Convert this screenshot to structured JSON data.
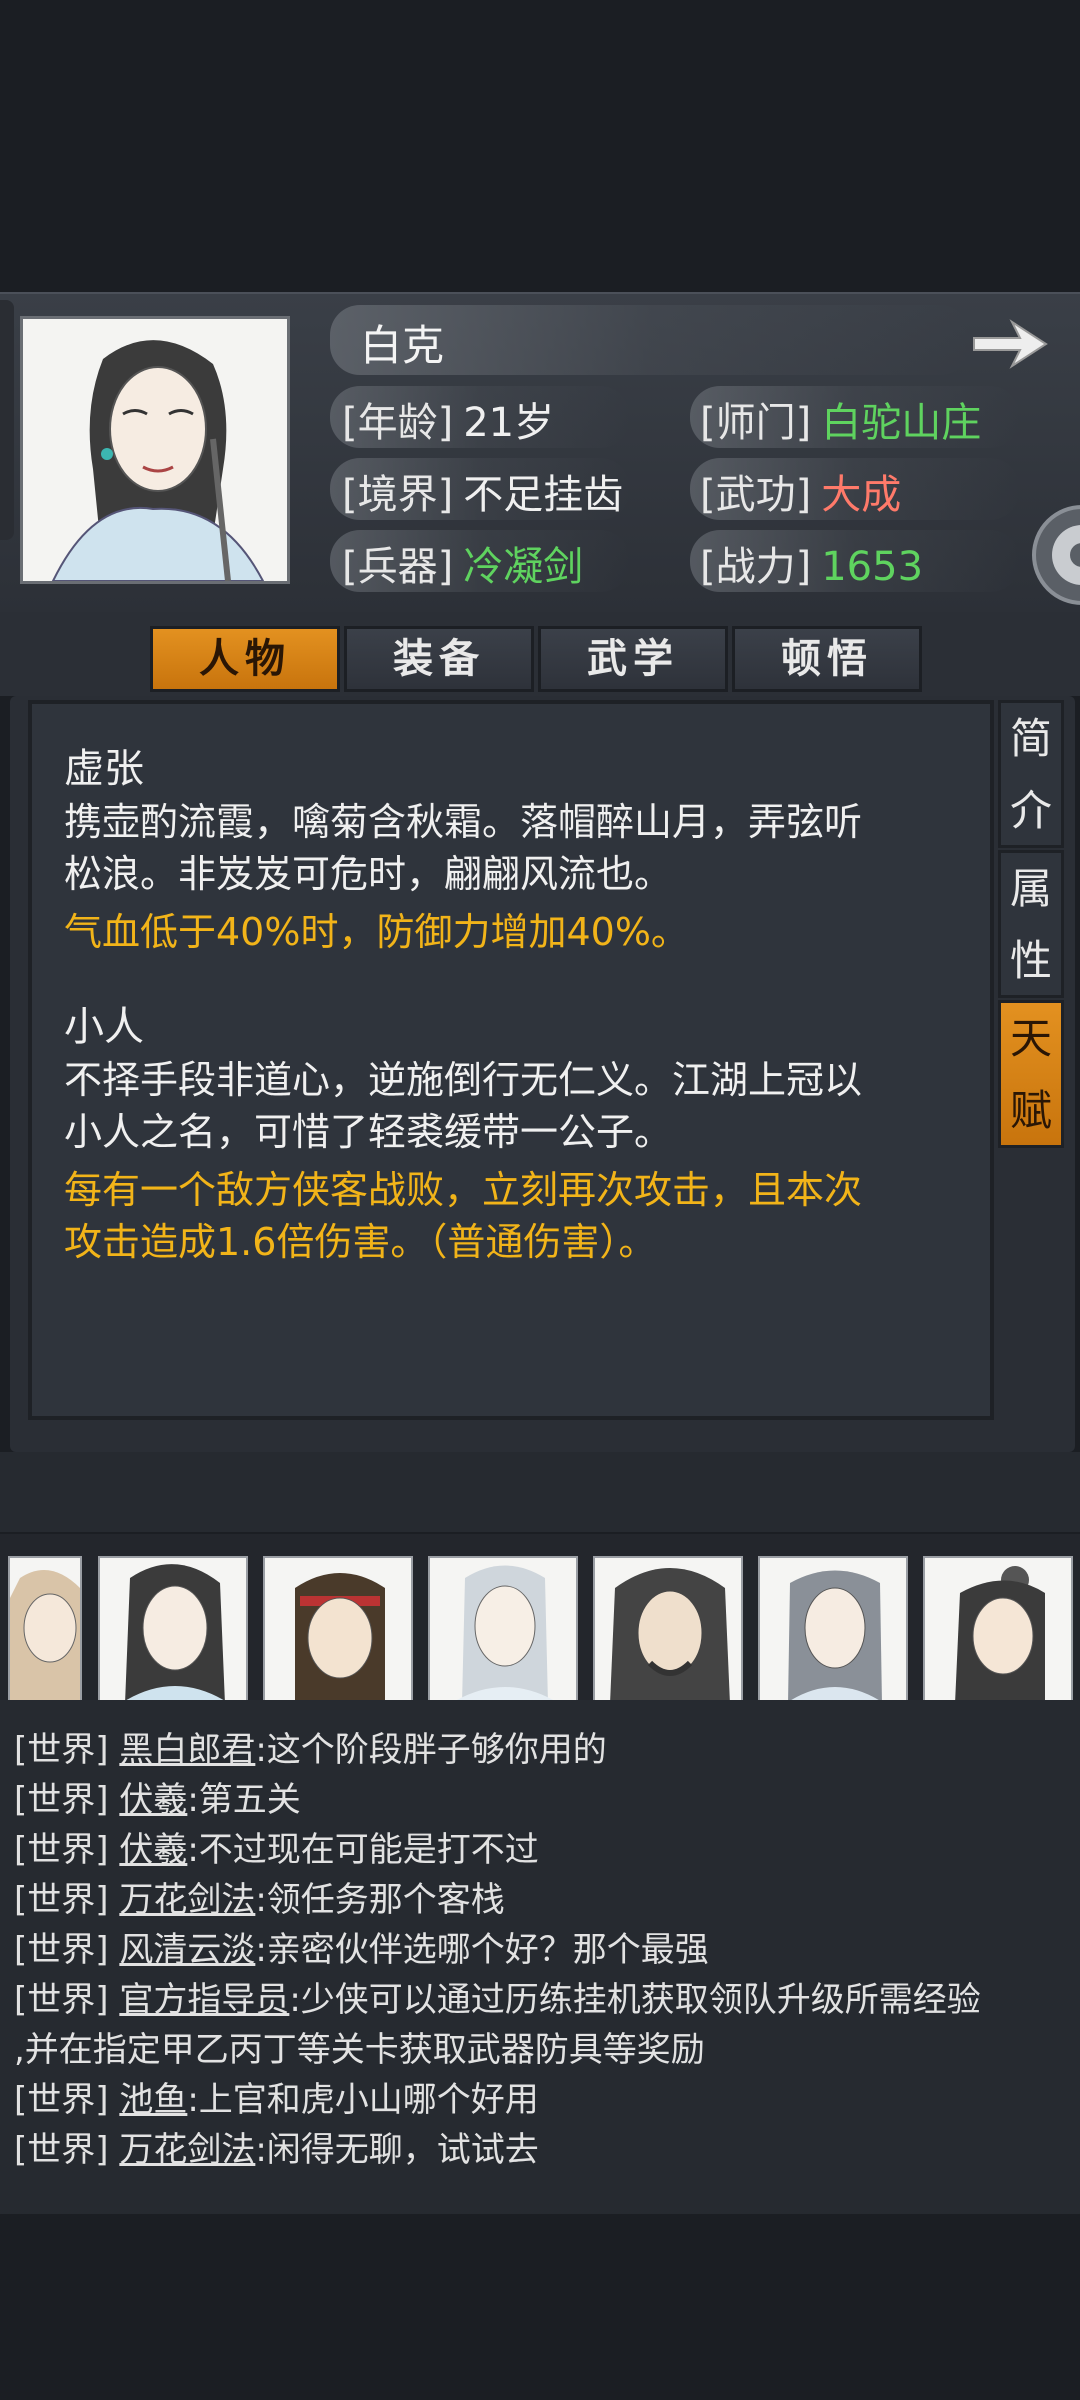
{
  "character": {
    "name": "白克",
    "age_label": "[年龄]",
    "age_value": "21岁",
    "sect_label": "[师门]",
    "sect_value": "白驼山庄",
    "realm_label": "[境界]",
    "realm_value": "不足挂齿",
    "martial_label": "[武功]",
    "martial_value": "大成",
    "weapon_label": "[兵器]",
    "weapon_value": "冷凝剑",
    "power_label": "[战力]",
    "power_value": "1653"
  },
  "tabs": [
    "人物",
    "装备",
    "武学",
    "顿悟"
  ],
  "side_tabs": [
    {
      "line1": "简",
      "line2": "介"
    },
    {
      "line1": "属",
      "line2": "性"
    },
    {
      "line1": "天",
      "line2": "赋"
    }
  ],
  "talents": [
    {
      "title": "虚张",
      "desc": [
        "携壶酌流霞，噙菊含秋霜。落帽醉山月，弄弦听",
        "松浪。非岌岌可危时，翩翩风流也。"
      ],
      "effect": [
        "气血低于40%时，防御力增加40%。"
      ]
    },
    {
      "title": "小人",
      "desc": [
        "不择手段非道心，逆施倒行无仁义。江湖上冠以",
        "小人之名，可惜了轻裘缓带一公子。"
      ],
      "effect": [
        "每有一个敌方侠客战败，立刻再次攻击，且本次",
        "攻击造成1.6倍伤害。（普通伤害）。"
      ]
    }
  ],
  "chat": [
    {
      "channel": "[世界]",
      "who": "黑白郎君",
      "msg": ":这个阶段胖子够你用的"
    },
    {
      "channel": "[世界]",
      "who": "伏羲",
      "msg": ":第五关"
    },
    {
      "channel": "[世界]",
      "who": "伏羲",
      "msg": ":不过现在可能是打不过"
    },
    {
      "channel": "[世界]",
      "who": "万花剑法",
      "msg": ":领任务那个客栈"
    },
    {
      "channel": "[世界]",
      "who": "风清云淡",
      "msg": ":亲密伙伴选哪个好？那个最强"
    },
    {
      "channel": "[世界]",
      "who": "官方指导员",
      "msg": ":少侠可以通过历练挂机获取领队升级所需经验"
    },
    {
      "channel": "",
      "who": "",
      "msg": ",并在指定甲乙丙丁等关卡获取武器防具等奖励"
    },
    {
      "channel": "[世界]",
      "who": "池鱼",
      "msg": ":上官和虎小山哪个好用"
    },
    {
      "channel": "[世界]",
      "who": "万花剑法",
      "msg": ":闲得无聊，试试去"
    }
  ],
  "colors": {
    "green": "#5fd35f",
    "red": "#ff7a6a",
    "orange": "#e39120",
    "gold": "#f2b419"
  }
}
